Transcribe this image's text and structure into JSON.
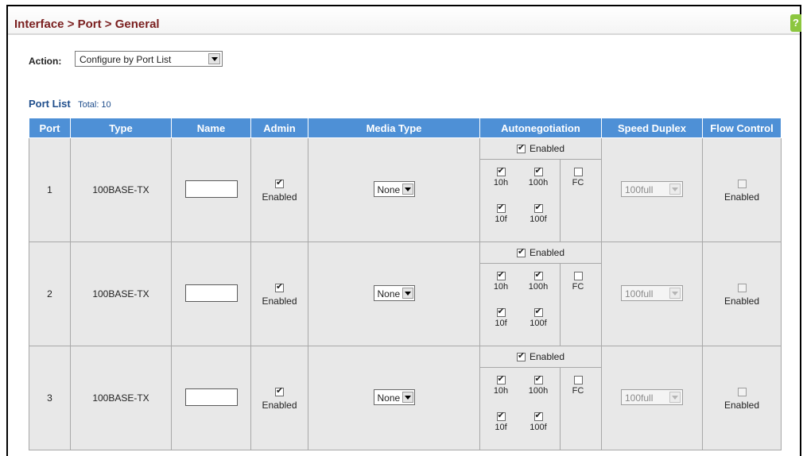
{
  "header": {
    "title": "Interface > Port > General",
    "help_icon": "?"
  },
  "action": {
    "label": "Action:",
    "selected": "Configure by Port List"
  },
  "port_list": {
    "title": "Port List",
    "total": "Total: 10"
  },
  "columns": [
    "Port",
    "Type",
    "Name",
    "Admin",
    "Media Type",
    "Autonegotiation",
    "Speed Duplex",
    "Flow Control"
  ],
  "rows": [
    {
      "port": "1",
      "type": "100BASE-TX",
      "name": "",
      "admin_enabled": true,
      "admin_label": "Enabled",
      "media_type": "None",
      "auto_enabled": true,
      "auto_label": "Enabled",
      "caps": {
        "10h": {
          "checked": true,
          "label": "10h"
        },
        "100h": {
          "checked": true,
          "label": "100h"
        },
        "fc": {
          "checked": false,
          "label": "FC"
        },
        "10f": {
          "checked": true,
          "label": "10f"
        },
        "100f": {
          "checked": true,
          "label": "100f"
        }
      },
      "speed_duplex": "100full",
      "flow_control_enabled": false,
      "flow_label": "Enabled"
    },
    {
      "port": "2",
      "type": "100BASE-TX",
      "name": "",
      "admin_enabled": true,
      "admin_label": "Enabled",
      "media_type": "None",
      "auto_enabled": true,
      "auto_label": "Enabled",
      "caps": {
        "10h": {
          "checked": true,
          "label": "10h"
        },
        "100h": {
          "checked": true,
          "label": "100h"
        },
        "fc": {
          "checked": false,
          "label": "FC"
        },
        "10f": {
          "checked": true,
          "label": "10f"
        },
        "100f": {
          "checked": true,
          "label": "100f"
        }
      },
      "speed_duplex": "100full",
      "flow_control_enabled": false,
      "flow_label": "Enabled"
    },
    {
      "port": "3",
      "type": "100BASE-TX",
      "name": "",
      "admin_enabled": true,
      "admin_label": "Enabled",
      "media_type": "None",
      "auto_enabled": true,
      "auto_label": "Enabled",
      "caps": {
        "10h": {
          "checked": true,
          "label": "10h"
        },
        "100h": {
          "checked": true,
          "label": "100h"
        },
        "fc": {
          "checked": false,
          "label": "FC"
        },
        "10f": {
          "checked": true,
          "label": "10f"
        },
        "100f": {
          "checked": true,
          "label": "100f"
        }
      },
      "speed_duplex": "100full",
      "flow_control_enabled": false,
      "flow_label": "Enabled"
    }
  ],
  "colors": {
    "title": "#7a1f1f",
    "section": "#1f4e8c",
    "header_bg": "#4e90d6",
    "row_bg": "#e8e8e8",
    "help_icon": "#8cc63f"
  }
}
